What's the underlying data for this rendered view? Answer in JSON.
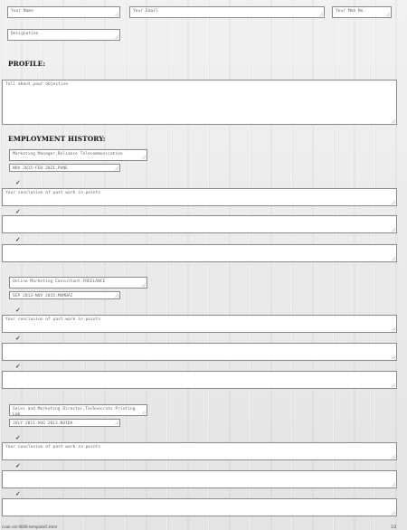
{
  "personal": {
    "name_placeholder": "Your Name",
    "email_placeholder": "Your Email",
    "mobile_placeholder": "Your Mob No.",
    "designation_placeholder": "Designation"
  },
  "profile": {
    "heading": "PROFILE:",
    "objective_placeholder": "Tell about your objective"
  },
  "employment": {
    "heading": "EMPLOYMENT HISTORY:",
    "check_mark": "✓",
    "jobs": [
      {
        "title": "Marketing Manager,Reliance Telecommunication",
        "period": "NOV 2015-FEB 2021,PUNE",
        "points": [
          "Your conclusion of past work in points",
          "",
          ""
        ]
      },
      {
        "title": "Online Marketing Consultant,FREELANCE",
        "period": "SEP 2013-NOV 2015,MUMBAI",
        "points": [
          "Your conclusion of past work in points",
          "",
          ""
        ]
      },
      {
        "title": "Sales and Marketing Director,Technocrats Printing Lab",
        "period": "JULY 2011-AUG 2013,NOIDA",
        "points": [
          "Your conclusion of past work in points",
          "",
          ""
        ]
      }
    ]
  },
  "footer": {
    "left": "cvuk-cvt-0006-template5.html",
    "right": "1/2"
  }
}
